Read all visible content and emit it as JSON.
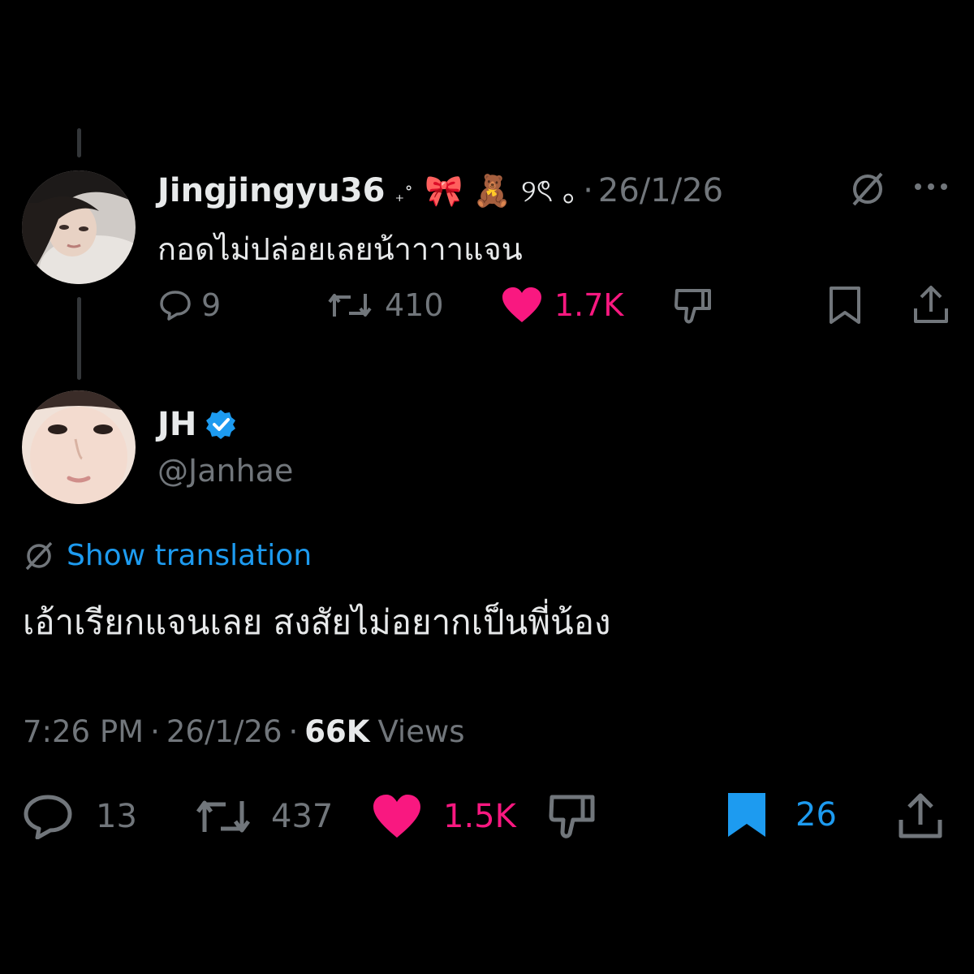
{
  "reply_tweet": {
    "display_name": "Jingjingyu36",
    "name_decor": "₊˚",
    "name_emoji": "🎀 🧸 ୨ৎ ｡",
    "separator": "·",
    "date": "26/1/26",
    "text": "กอดไม่ปล่อยเลยน้าาาาแจน",
    "actions": {
      "replies": "9",
      "retweets": "410",
      "likes": "1.7K"
    },
    "icons": [
      "translate-icon",
      "more-icon",
      "reply-icon",
      "retweet-icon",
      "heart-icon",
      "dislike-icon",
      "bookmark-icon",
      "share-icon"
    ]
  },
  "main_tweet": {
    "display_name": "JH",
    "handle": "@Janhae",
    "verified": true,
    "show_translation": "Show translation",
    "text": "เอ้าเรียกแจนเลย สงสัยไม่อยากเป็นพี่น้อง",
    "time": "7:26 PM",
    "sep1": "·",
    "date": "26/1/26",
    "sep2": "·",
    "views_count": "66K",
    "views_label": "Views",
    "actions": {
      "replies": "13",
      "retweets": "437",
      "likes": "1.5K",
      "bookmarks": "26"
    }
  },
  "colors": {
    "background": "#000000",
    "text": "#e7e9ea",
    "muted": "#71767b",
    "like": "#f91880",
    "accent": "#1d9bf0"
  }
}
